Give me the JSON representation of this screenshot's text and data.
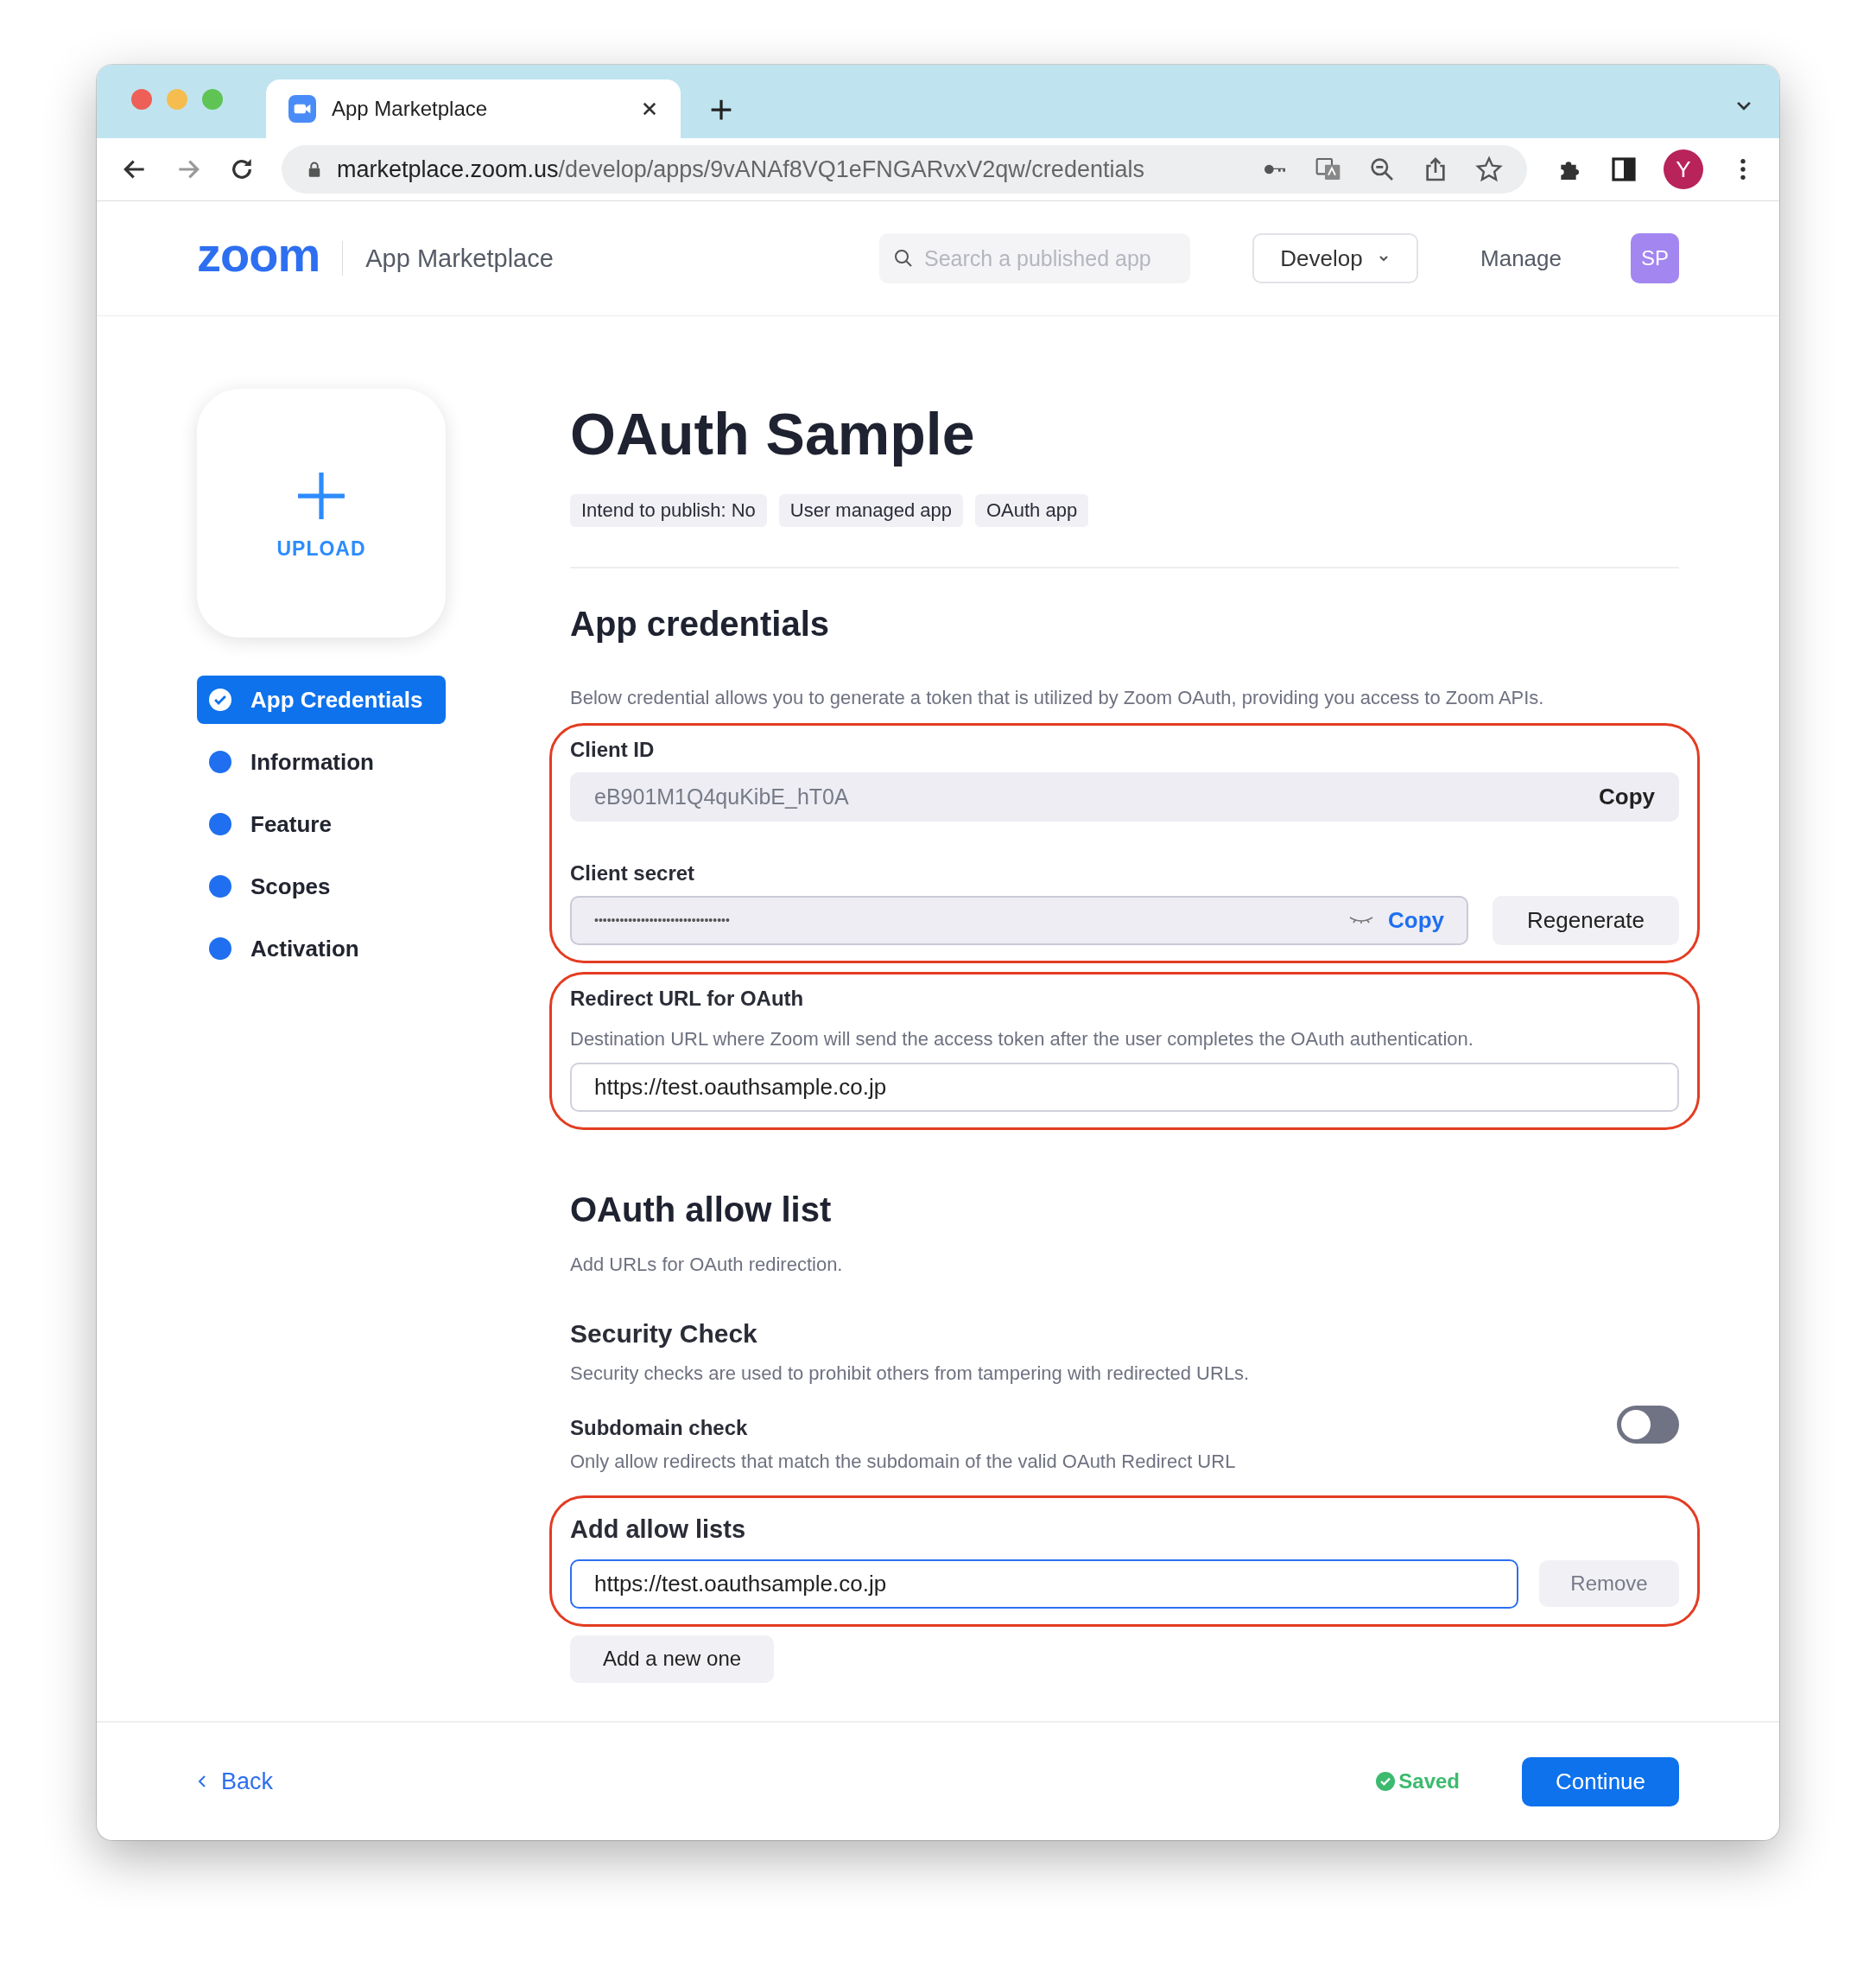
{
  "browser": {
    "tab_title": "App Marketplace",
    "url_host": "marketplace.zoom.us",
    "url_path": "/develop/apps/9vANAf8VQ1eFNGARvxV2qw/credentials",
    "profile": "Y"
  },
  "header": {
    "logo": "zoom",
    "product": "App Marketplace",
    "search_placeholder": "Search a published app",
    "develop": "Develop",
    "manage": "Manage",
    "avatar": "SP"
  },
  "sidebar": {
    "upload": "UPLOAD",
    "items": [
      {
        "label": "App Credentials",
        "selected": true
      },
      {
        "label": "Information",
        "selected": false
      },
      {
        "label": "Feature",
        "selected": false
      },
      {
        "label": "Scopes",
        "selected": false
      },
      {
        "label": "Activation",
        "selected": false
      }
    ]
  },
  "app": {
    "title": "OAuth Sample",
    "tags": [
      "Intend to publish: No",
      "User managed app",
      "OAuth app"
    ]
  },
  "credentials": {
    "heading": "App credentials",
    "description": "Below credential allows you to generate a token that is utilized by Zoom OAuth, providing you access to Zoom APIs.",
    "client_id": {
      "label": "Client ID",
      "value": "eB901M1Q4quKibE_hT0A",
      "copy": "Copy"
    },
    "client_secret": {
      "label": "Client secret",
      "value": "••••••••••••••••••••••••••••••••",
      "copy": "Copy",
      "regenerate": "Regenerate"
    },
    "redirect": {
      "label": "Redirect URL for OAuth",
      "description": "Destination URL where Zoom will send the access token after the user completes the OAuth authentication.",
      "value": "https://test.oauthsample.co.jp"
    }
  },
  "allow_list": {
    "heading": "OAuth allow list",
    "description": "Add URLs for OAuth redirection.",
    "security_heading": "Security Check",
    "security_description": "Security checks are used to prohibit others from tampering with redirected URLs.",
    "subdomain": {
      "label": "Subdomain check",
      "description": "Only allow redirects that match the subdomain of the valid OAuth Redirect URL",
      "on": false
    },
    "add_heading": "Add allow lists",
    "entries": [
      {
        "value": "https://test.oauthsample.co.jp",
        "remove": "Remove"
      }
    ],
    "add_button": "Add a new one"
  },
  "footer": {
    "back": "Back",
    "saved": "Saved",
    "continue": "Continue"
  }
}
